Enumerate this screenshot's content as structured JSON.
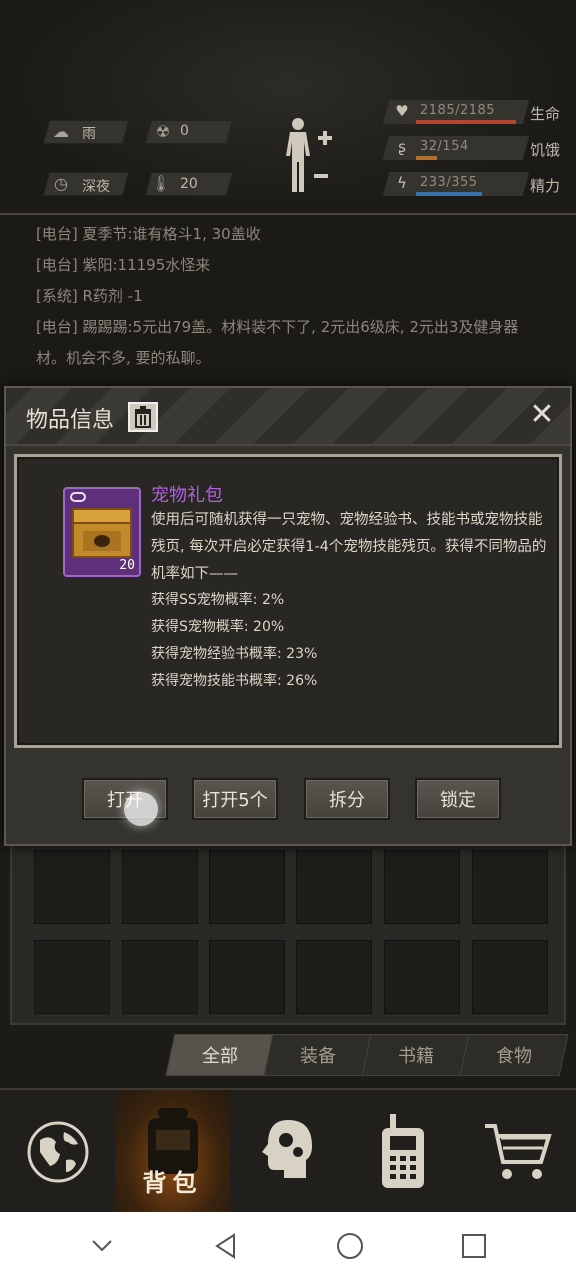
{
  "status": {
    "weather": "雨",
    "radiation": "0",
    "time_of_day": "深夜",
    "temperature": "20",
    "health": {
      "value": "2185/2185",
      "label": "生命",
      "fraction": 1.0,
      "color": "#b4442e"
    },
    "hunger": {
      "value": "32/154",
      "label": "饥饿",
      "fraction": 0.21,
      "color": "#b2702a"
    },
    "energy": {
      "value": "233/355",
      "label": "精力",
      "fraction": 0.66,
      "color": "#3a6fa8"
    }
  },
  "messages": [
    "[电台] 夏季节:谁有格斗1, 30盖收",
    "[电台] 紫阳:11195水怪来",
    "[系统] R药剂 -1",
    "[电台] 踢踢踢:5元出79盖。材料装不下了, 2元出6级床, 2元出3及健身器",
    "材。机会不多, 要的私聊。"
  ],
  "dialog": {
    "title": "物品信息",
    "item": {
      "name": "宠物礼包",
      "count": "20",
      "description": "使用后可随机获得一只宠物、宠物经验书、技能书或宠物技能残页, 每次开启必定获得1-4个宠物技能残页。获得不同物品的机率如下——",
      "odds": [
        "获得SS宠物概率: 2%",
        "获得S宠物概率: 20%",
        "获得宠物经验书概率: 23%",
        "获得宠物技能书概率: 26%"
      ]
    },
    "buttons": {
      "open": "打开",
      "open5": "打开5个",
      "split": "拆分",
      "lock": "锁定"
    }
  },
  "tabs": [
    "全部",
    "装备",
    "书籍",
    "食物"
  ],
  "nav": {
    "bag_label": "背包"
  }
}
